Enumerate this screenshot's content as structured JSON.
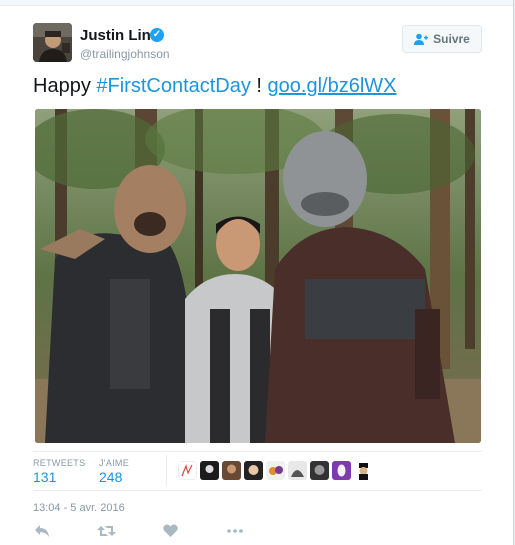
{
  "user": {
    "name": "Justin Lin",
    "handle": "@trailingjohnson",
    "verified_glyph": "✓"
  },
  "follow_button": {
    "label": "Suivre",
    "icon": "follow-user-icon"
  },
  "tweet": {
    "prefix": "Happy ",
    "hashtag": "#FirstContactDay",
    "middle": " ! ",
    "link": "goo.gl/bz6lWX"
  },
  "photo": {
    "icon": "tweet-photo"
  },
  "stats": {
    "retweets_label": "RETWEETS",
    "retweets_value": "131",
    "likes_label": "J'AIME",
    "likes_value": "248"
  },
  "timestamp": "13:04 - 5 avr. 2016",
  "actions": [
    "reply-icon",
    "retweet-icon",
    "like-icon",
    "more-icon"
  ],
  "colors": {
    "link": "#1b95e0",
    "muted": "#8899a6",
    "verified": "#1da1f2"
  }
}
